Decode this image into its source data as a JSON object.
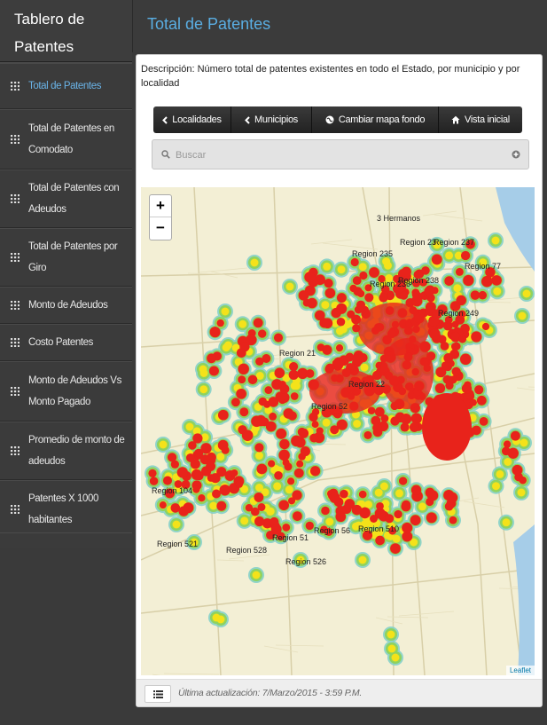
{
  "app": {
    "brand": "Tablero de Patentes",
    "title": "Total de Patentes"
  },
  "sidebar": {
    "items": [
      {
        "label": "Total de Patentes",
        "active": true,
        "icon": "grid-icon"
      },
      {
        "label": "Total de Patentes en Comodato",
        "active": false,
        "icon": "grid-icon"
      },
      {
        "label": "Total de Patentes con Adeudos",
        "active": false,
        "icon": "grid-icon"
      },
      {
        "label": "Total de Patentes por Giro",
        "active": false,
        "icon": "grid-icon"
      },
      {
        "label": "Monto de Adeudos",
        "active": false,
        "icon": "grid-icon"
      },
      {
        "label": "Costo Patentes",
        "active": false,
        "icon": "grid-icon"
      },
      {
        "label": "Monto de Adeudos Vs Monto Pagado",
        "active": false,
        "icon": "grid-icon"
      },
      {
        "label": "Promedio de monto de adeudos",
        "active": false,
        "icon": "grid-icon"
      },
      {
        "label": "Patentes X 1000 habitantes",
        "active": false,
        "icon": "grid-icon"
      }
    ]
  },
  "description": "Descripción: Número total de patentes existentes en todo el Estado, por municipio y por localidad",
  "toolbar": {
    "localidades": "Localidades",
    "municipios": "Municipios",
    "cambiar_mapa": "Cambiar mapa fondo",
    "vista_inicial": "Vista inicial"
  },
  "search": {
    "placeholder": "Buscar"
  },
  "map": {
    "zoom_in": "+",
    "zoom_out": "−",
    "attribution": "Leaflet",
    "labels": [
      "3 Hermanos",
      "Region 23",
      "Region 237",
      "Region 77",
      "Region 235",
      "Region 238",
      "Region 236",
      "Region 249",
      "Region 21",
      "Region 22",
      "Region 52",
      "Region 104",
      "Region 521",
      "Region 528",
      "Region 526",
      "Region 51",
      "Region 56",
      "Region 510"
    ],
    "colors": {
      "hot": "#e8231b",
      "warm": "#f4e21a",
      "mild": "#8fd25a",
      "cool": "#7fd0c8"
    }
  },
  "footer": {
    "updated": "Última actualización: 7/Marzo/2015 - 3:59 P.M."
  }
}
